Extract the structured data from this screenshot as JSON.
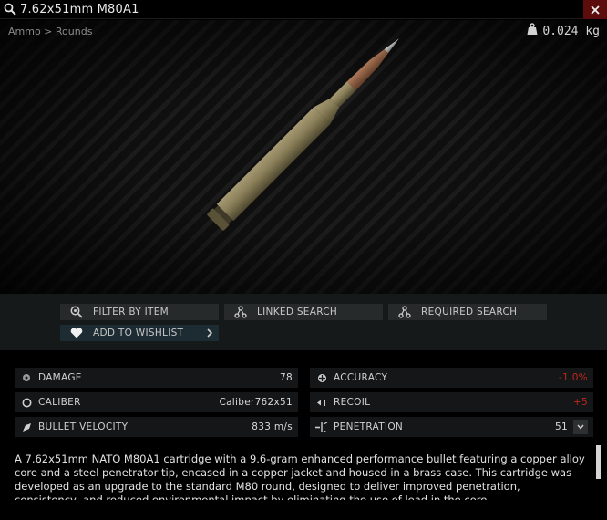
{
  "window": {
    "title": "7.62x51mm M80A1",
    "search_icon": "search-icon",
    "close_icon": "close-icon"
  },
  "viewer": {
    "breadcrumb": "Ammo > Rounds",
    "weight": "0.024 kg",
    "weight_icon": "weight-icon"
  },
  "actions": {
    "filter_by_item": "FILTER BY ITEM",
    "linked_search": "LINKED SEARCH",
    "required_search": "REQUIRED SEARCH",
    "add_to_wishlist": "ADD TO WISHLIST"
  },
  "stats": {
    "damage": {
      "label": "DAMAGE",
      "value": "78"
    },
    "caliber": {
      "label": "CALIBER",
      "value": "Caliber762x51"
    },
    "bullet_velocity": {
      "label": "BULLET VELOCITY",
      "value": "833 m/s"
    },
    "accuracy": {
      "label": "ACCURACY",
      "value": "-1.0%"
    },
    "recoil": {
      "label": "RECOIL",
      "value": "+5"
    },
    "penetration": {
      "label": "PENETRATION",
      "value": "51"
    }
  },
  "colors": {
    "negative": "#c0271f",
    "close_bg": "#5c0c0c",
    "panel": "#141617"
  },
  "description": "A 7.62x51mm NATO M80A1 cartridge with a 9.6-gram enhanced performance bullet featuring a copper alloy core and a steel penetrator tip, encased in a copper jacket and housed in a brass case. This cartridge was developed as an upgrade to the standard M80 round, designed to deliver improved penetration, consistency, and reduced environmental impact by eliminating the use of lead in the core."
}
